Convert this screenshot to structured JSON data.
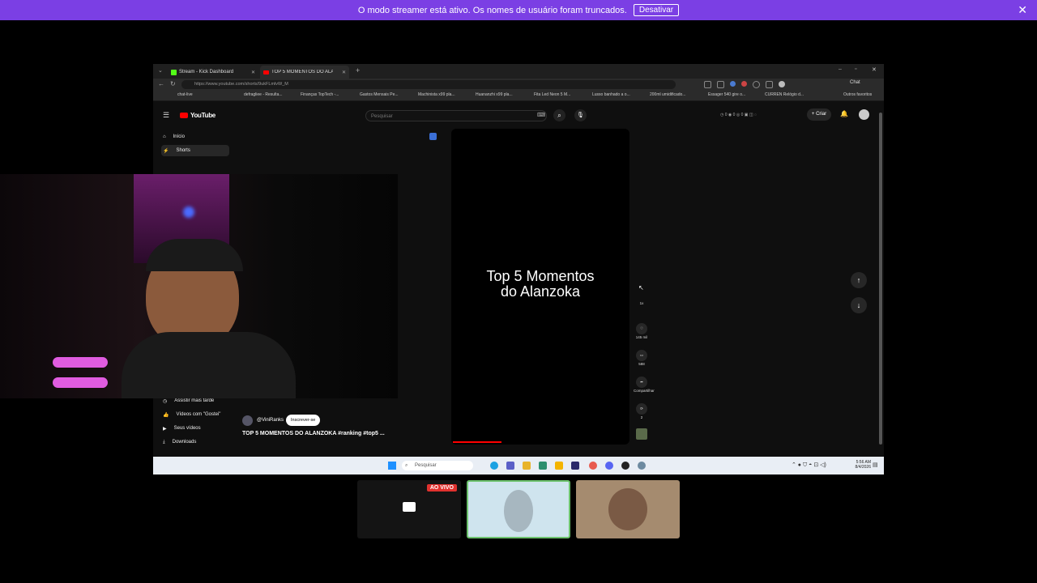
{
  "banner": {
    "message": "O modo streamer está ativo. Os nomes de usuário foram truncados.",
    "button_label": "Desativar",
    "color": "#7b3fe4"
  },
  "browser": {
    "tabs": [
      {
        "label": "Stream - Kick Dashboard",
        "active": false
      },
      {
        "label": "TOP 5 MOMENTOS DO ALAN",
        "active": true
      }
    ],
    "url": "https://www.youtube.com/shorts/9ukFLmlvW_M",
    "chat_label": "Chat",
    "bookmarks": [
      "chat-live",
      "defragliee - Resulta...",
      "Finanças TopTech -...",
      "Gastos Mensais Pe...",
      "Machinista x99 pla...",
      "Huananzhi x99 pla...",
      "Fita Led Neon 5 M...",
      "Lusso banhado a o...",
      "200ml umidificado...",
      "Essager 540 gire o...",
      "CURREN Relógio d..."
    ],
    "other_favorites": "Outros favoritos"
  },
  "youtube": {
    "logo": "YouTube",
    "search_placeholder": "Pesquisar",
    "create_label": "Criar",
    "sidebar_top": [
      {
        "label": "Início"
      },
      {
        "label": "Shorts"
      }
    ],
    "sidebar_bottom": [
      {
        "label": "Assistir mais tarde"
      },
      {
        "label": "Vídeos com \"Gostei\""
      },
      {
        "label": "Seus vídeos"
      },
      {
        "label": "Downloads"
      }
    ],
    "short": {
      "title_line1": "Top 5 Momentos",
      "title_line2": "do Alanzoka",
      "channel": "@ViniRanks",
      "subscribe_label": "Inscrever-se",
      "video_title": "TOP 5 MOMENTOS DO ALANZOKA #ranking #top5 ...",
      "likes": "145 mil",
      "comments": "588",
      "share_label": "Compartilhar",
      "remix_count": "2",
      "speed": "1x"
    }
  },
  "taskbar": {
    "search_placeholder": "Pesquisar",
    "time": "5:56 AM",
    "date": "8/4/2026"
  },
  "bottom_thumbs": {
    "live_badge": "AO VIVO"
  }
}
